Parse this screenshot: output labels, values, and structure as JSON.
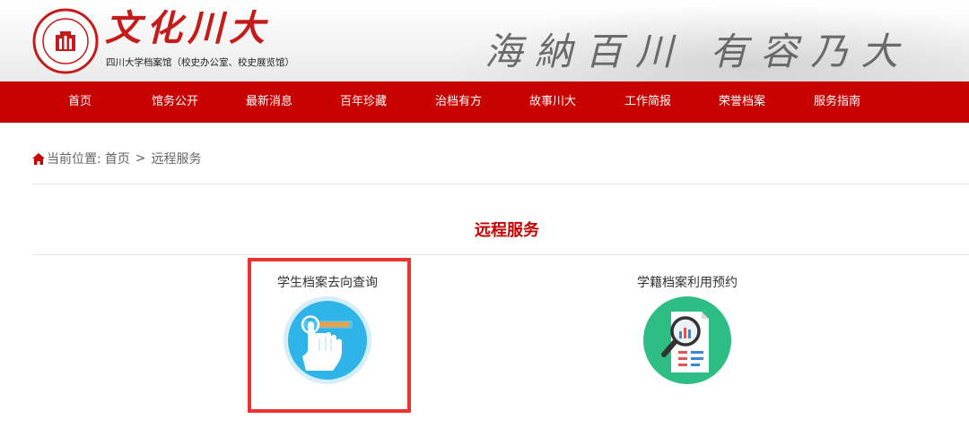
{
  "header": {
    "logo_title": "文化川大",
    "logo_subtitle": "四川大学档案馆（校史办公室、校史展览馆）",
    "motto": "海納百川 有容乃大"
  },
  "nav": {
    "items": [
      {
        "label": "首页"
      },
      {
        "label": "馆务公开"
      },
      {
        "label": "最新消息"
      },
      {
        "label": "百年珍藏"
      },
      {
        "label": "治档有方"
      },
      {
        "label": "故事川大"
      },
      {
        "label": "工作简报"
      },
      {
        "label": "荣誉档案"
      },
      {
        "label": "服务指南"
      }
    ]
  },
  "breadcrumb": {
    "prefix": "当前位置:",
    "home": "首页",
    "separator": ">",
    "current": "远程服务"
  },
  "section": {
    "title": "远程服务"
  },
  "services": [
    {
      "label": "学生档案去向查询",
      "icon": "touch-query-icon",
      "highlighted": true
    },
    {
      "label": "学籍档案利用预约",
      "icon": "document-magnifier-icon",
      "highlighted": false
    }
  ],
  "colors": {
    "brand_red": "#c70000",
    "highlight_red": "#ee3232",
    "icon_blue": "#2fb4ea",
    "icon_green": "#2ebd85"
  }
}
